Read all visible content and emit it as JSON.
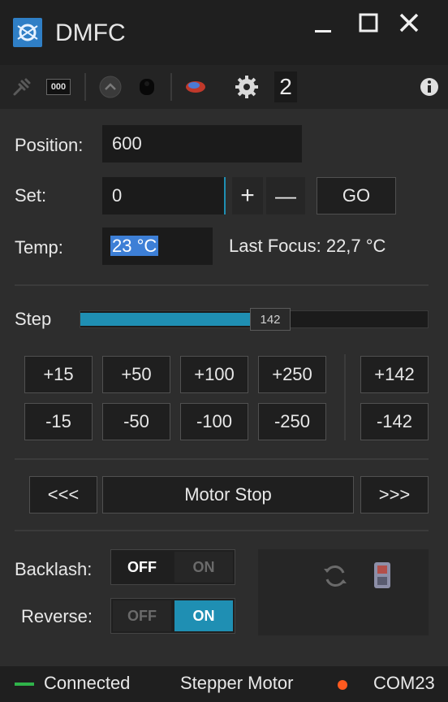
{
  "window": {
    "title": "DMFC"
  },
  "toolbar": {
    "device_number": "2",
    "io_label": "000"
  },
  "position": {
    "label": "Position:",
    "value": "600"
  },
  "set": {
    "label": "Set:",
    "value": "0",
    "plus": "+",
    "minus": "—",
    "go": "GO"
  },
  "temp": {
    "label": "Temp:",
    "value": "23 °C",
    "last_focus": "Last Focus: 22,7 °C"
  },
  "step": {
    "label": "Step",
    "value": "142",
    "slider_fraction": 0.49
  },
  "step_buttons": {
    "plus": [
      "+15",
      "+50",
      "+100",
      "+250"
    ],
    "minus": [
      "-15",
      "-50",
      "-100",
      "-250"
    ],
    "custom_plus": "+142",
    "custom_minus": "-142"
  },
  "motor": {
    "left": "<<<",
    "stop": "Motor Stop",
    "right": ">>>"
  },
  "backlash": {
    "label": "Backlash:",
    "off": "OFF",
    "on": "ON",
    "state": "OFF"
  },
  "reverse": {
    "label": "Reverse:",
    "off": "OFF",
    "on": "ON",
    "state": "ON"
  },
  "status": {
    "connection": "Connected",
    "motor_type": "Stepper Motor",
    "port": "COM23"
  },
  "colors": {
    "accent": "#1f8fb3",
    "connected": "#2fb34a",
    "port_indicator": "#ff5a1f"
  }
}
